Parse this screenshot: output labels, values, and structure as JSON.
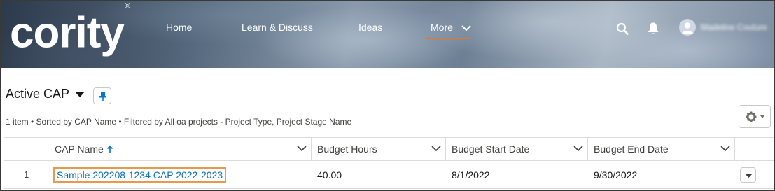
{
  "brand": {
    "logo_text": "cority",
    "trademark": "®",
    "accent": "#e87722"
  },
  "nav": {
    "items": [
      {
        "label": "Home"
      },
      {
        "label": "Learn & Discuss"
      },
      {
        "label": "Ideas"
      },
      {
        "label": "More"
      }
    ],
    "active": "More"
  },
  "header_icons": [
    "search-icon",
    "bell-icon",
    "avatar"
  ],
  "user": {
    "name": "Madeline Couture"
  },
  "list_view": {
    "title": "Active CAP",
    "subtitle": "1 item • Sorted by CAP Name • Filtered by All oa projects - Project Type, Project Stage Name"
  },
  "table": {
    "columns": [
      {
        "label": "CAP Name",
        "sorted": "ascending"
      },
      {
        "label": "Budget Hours"
      },
      {
        "label": "Budget Start Date"
      },
      {
        "label": "Budget End Date"
      }
    ],
    "rows": [
      {
        "num": "1",
        "cap_name": "Sample 202208-1234 CAP 2022-2023",
        "budget_hours": "40.00",
        "budget_start_date": "8/1/2022",
        "budget_end_date": "9/30/2022"
      }
    ]
  },
  "colors": {
    "link": "#0b6fb6",
    "highlight_border": "#e89a4c",
    "pin": "#0176d3"
  }
}
